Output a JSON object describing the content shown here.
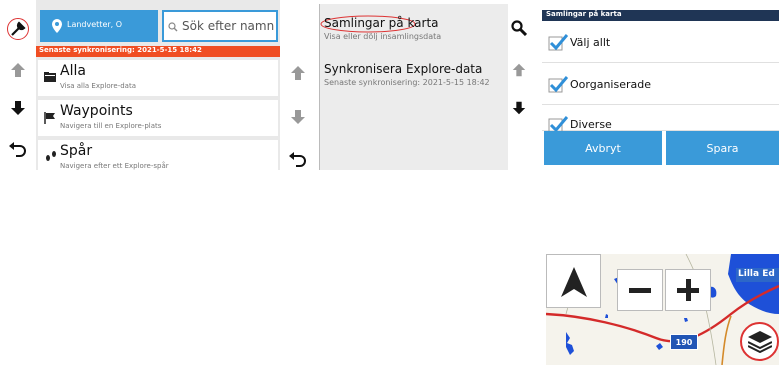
{
  "screen1": {
    "location_label": "Landvetter, O",
    "search_placeholder": "Sök efter namn",
    "sync_banner": "Senaste synkronisering: 2021-5-15 18:42",
    "items": [
      {
        "title": "Alla",
        "subtitle": "Visa alla Explore-data"
      },
      {
        "title": "Waypoints",
        "subtitle": "Navigera till en Explore-plats"
      },
      {
        "title": "Spår",
        "subtitle": "Navigera efter ett Explore-spår"
      }
    ]
  },
  "screen2": {
    "items": [
      {
        "title": "Samlingar på karta",
        "subtitle": "Visa eller dölj insamlingsdata"
      },
      {
        "title": "Synkronisera Explore-data",
        "subtitle": "Senaste synkronisering: 2021-5-15 18:42"
      }
    ]
  },
  "screen3": {
    "header": "Samlingar på karta",
    "options": [
      {
        "label": "Välj allt",
        "checked": true
      },
      {
        "label": "Oorganiserade",
        "checked": true
      },
      {
        "label": "Diverse",
        "checked": true
      }
    ],
    "cancel_label": "Avbryt",
    "save_label": "Spara"
  },
  "map": {
    "route_number": "190",
    "place_label": "Lilla Ed"
  },
  "colors": {
    "accent_blue": "#3a9ad9",
    "sync_red": "#f04e23",
    "header_navy": "#1f3555",
    "check_blue": "#2f8fd8"
  }
}
